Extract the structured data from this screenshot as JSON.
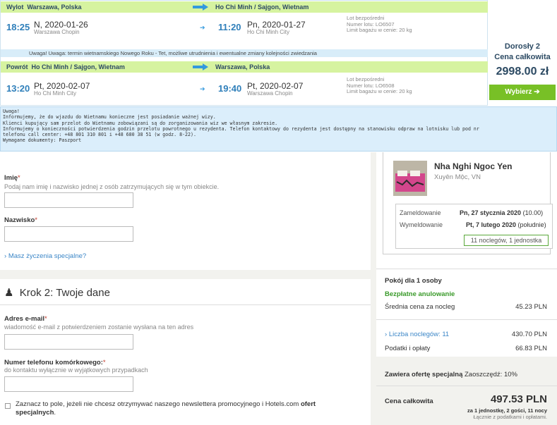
{
  "flight": {
    "outbound": {
      "label": "Wylot",
      "from": "Warszawa, Polska",
      "to": "Ho Chi Minh / Sajgon, Wietnam",
      "dep_time": "18:25",
      "dep_date": "N, 2020-01-26",
      "dep_city": "Warszawa Chopin",
      "arr_time": "11:20",
      "arr_date": "Pn, 2020-01-27",
      "arr_city": "Ho Chi Minh City",
      "details": [
        "Lot bezpośredni",
        "Numer lotu: LO6507",
        "Limit bagażu w cenie: 20 kg"
      ]
    },
    "notice": "Uwaga! Uwaga: termin wietnamskiego Nowego Roku - Tet, możliwe utrudnienia i ewentualne zmiany kolejności zwiedzania",
    "return": {
      "label": "Powrót",
      "from": "Ho Chi Minh / Sajgon, Wietnam",
      "to": "Warszawa, Polska",
      "dep_time": "13:20",
      "dep_date": "Pt, 2020-02-07",
      "dep_city": "Ho Chi Minh City",
      "arr_time": "19:40",
      "arr_date": "Pt, 2020-02-07",
      "arr_city": "Warszawa Chopin",
      "details": [
        "Lot bezpośredni",
        "Numer lotu: LO6508",
        "Limit bagażu w cenie: 20 kg"
      ]
    },
    "price": {
      "pax": "Dorosły 2",
      "label": "Cena całkowita",
      "amount": "2998.00 zł",
      "button": "Wybierz"
    },
    "warning_lines": [
      "Uwaga!",
      "Informujemy, że do wjazdu do Wietnamu konieczne jest posiadanie ważnej wizy.",
      "Klienci kupujący sam przelot do Wietnamu zobowiązani są do zorganizowania wiz we własnym zakresie.",
      "Informujemy o konieczności potwierdzenia godzin przelotu powrotnego u rezydenta. Telefon kontaktowy do rezydenta jest dostępny na stanowisku odpraw na lotnisku lub pod nr",
      "telefonu call center: +48 801 310 801 i +48 680 38 51 (w godz. 8-22).",
      " Wymagane dokumenty: Paszport"
    ]
  },
  "form": {
    "first_name_label": "Imię",
    "first_name_hint": "Podaj nam imię i nazwisko jednej z osób zatrzymujących się w tym obiekcie.",
    "last_name_label": "Nazwisko",
    "special_requests": "Masz życzenia specjalne?",
    "step2_title": "Krok 2: Twoje dane",
    "email_label": "Adres e-mail",
    "email_hint": "wiadomość e-mail z potwierdzeniem zostanie wysłana na ten adres",
    "phone_label": "Numer telefonu komórkowego:",
    "phone_hint": "do kontaktu wyłącznie w wyjątkowych przypadkach",
    "newsletter_text": "Zaznacz to pole, jeżeli nie chcesz otrzymywać naszego newslettera promocyjnego i Hotels.com",
    "newsletter_bold": "ofert specjalnych"
  },
  "hotel": {
    "name": "Nha Nghi Ngoc Yen",
    "location": "Xuyên Mộc, VN",
    "checkin_label": "Zameldowanie",
    "checkin_value": "Pn, 27 stycznia 2020",
    "checkin_time": "(10.00)",
    "checkout_label": "Wymeldowanie",
    "checkout_value": "Pt, 7 lutego 2020",
    "checkout_time": "(południe)",
    "nights_badge": "11 noclegów, 1 jednostka",
    "room": "Pokój dla 1 osoby",
    "free_cancel": "Bezpłatne anulowanie",
    "avg_label": "Średnia cena za nocleg",
    "avg_value": "45.23 PLN",
    "nights_label": "Liczba noclegów: 11",
    "nights_value": "430.70 PLN",
    "tax_label": "Podatki i opłaty",
    "tax_value": "66.83 PLN",
    "offer_bold": "Zawiera ofertę specjalną",
    "offer_rest": "Zaoszczędź: 10%",
    "total_label": "Cena całkowita",
    "total_value": "497.53 PLN",
    "total_sub": "za 1 jednostkę, 2 gości, 11 nocy",
    "total_sub2": "Łącznie z podatkami i opłatami."
  },
  "colors": {
    "accent": "#3b86c7",
    "green": "#78c026",
    "highlight": "#d6f3a0"
  }
}
